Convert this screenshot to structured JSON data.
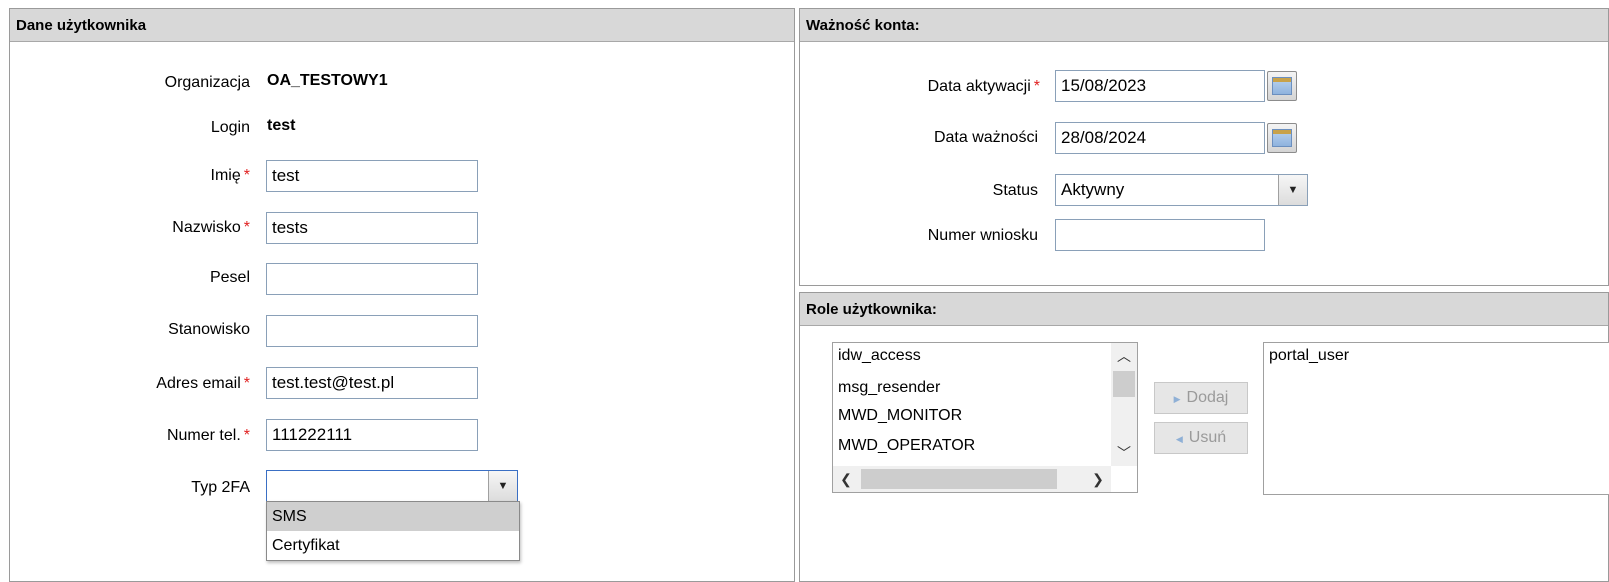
{
  "user_panel": {
    "title": "Dane użytkownika",
    "organization": {
      "label": "Organizacja",
      "value": "OA_TESTOWY1"
    },
    "login": {
      "label": "Login",
      "value": "test"
    },
    "first_name": {
      "label": "Imię",
      "value": "test",
      "required": true
    },
    "last_name": {
      "label": "Nazwisko",
      "value": "tests",
      "required": true
    },
    "pesel": {
      "label": "Pesel",
      "value": ""
    },
    "position": {
      "label": "Stanowisko",
      "value": ""
    },
    "email": {
      "label": "Adres email",
      "value": "test.test@test.pl",
      "required": true
    },
    "phone": {
      "label": "Numer tel.",
      "value": "111222111",
      "required": true
    },
    "twofa": {
      "label": "Typ 2FA",
      "value": "",
      "options": [
        "SMS",
        "Certyfikat"
      ],
      "highlighted_option": "SMS"
    }
  },
  "validity_panel": {
    "title": "Ważność konta:",
    "activation_date": {
      "label": "Data aktywacji",
      "value": "15/08/2023",
      "required": true
    },
    "expiry_date": {
      "label": "Data ważności",
      "value": "28/08/2024"
    },
    "status": {
      "label": "Status",
      "value": "Aktywny"
    },
    "request_number": {
      "label": "Numer wniosku",
      "value": ""
    }
  },
  "roles_panel": {
    "title": "Role użytkownika:",
    "available_roles": [
      "idw_access",
      "msg_resender",
      "MWD_MONITOR",
      "MWD_OPERATOR"
    ],
    "assigned_roles": [
      "portal_user"
    ],
    "add_label": "Dodaj",
    "remove_label": "Usuń"
  },
  "required_mark": "*",
  "icons": {
    "calendar": "calendar-icon",
    "dropdown": "chevron-down-icon",
    "scroll_up": "chevron-up-icon",
    "scroll_down": "chevron-down-icon",
    "scroll_left": "chevron-left-icon",
    "scroll_right": "chevron-right-icon",
    "add": "triangle-right-icon",
    "remove": "triangle-left-icon"
  },
  "colors": {
    "required": "#e02020",
    "header_bg": "#d8d8d8",
    "field_border": "#8aa0b8",
    "focus_border": "#3a6fc4"
  }
}
